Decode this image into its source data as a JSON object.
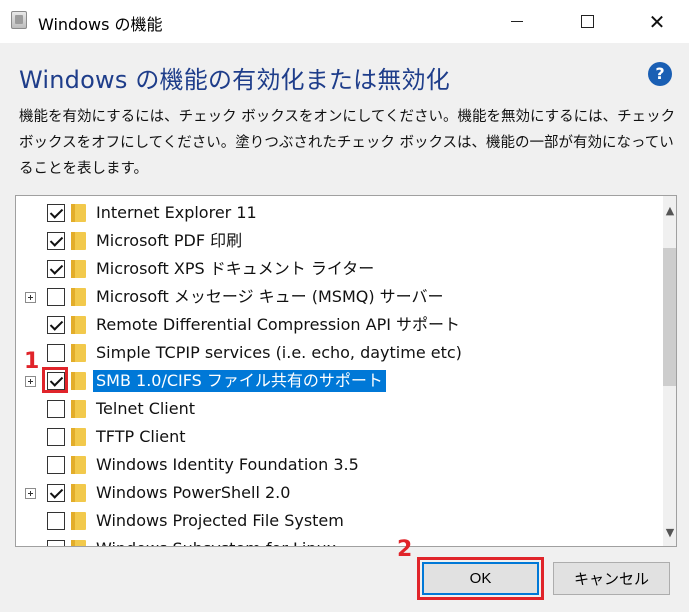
{
  "window": {
    "title": "Windows の機能",
    "controls": {
      "minimize": "minimize",
      "maximize": "maximize",
      "close": "✕"
    }
  },
  "heading": "Windows の機能の有効化または無効化",
  "help_icon": "?",
  "description_lines": [
    "機能を有効にするには、チェック ボックスをオンにしてください。機能を無効にするには、チェック",
    "ボックスをオフにしてください。塗りつぶされたチェック ボックスは、機能の一部が有効になってい",
    "ることを表します。"
  ],
  "features": [
    {
      "label": "Internet Explorer 11",
      "checked": true,
      "expandable": false,
      "selected": false
    },
    {
      "label": "Microsoft PDF 印刷",
      "checked": true,
      "expandable": false,
      "selected": false
    },
    {
      "label": "Microsoft XPS ドキュメント ライター",
      "checked": true,
      "expandable": false,
      "selected": false
    },
    {
      "label": "Microsoft メッセージ キュー (MSMQ) サーバー",
      "checked": false,
      "expandable": true,
      "selected": false
    },
    {
      "label": "Remote Differential Compression API サポート",
      "checked": true,
      "expandable": false,
      "selected": false
    },
    {
      "label": "Simple TCPIP services (i.e. echo, daytime etc)",
      "checked": false,
      "expandable": false,
      "selected": false
    },
    {
      "label": "SMB 1.0/CIFS ファイル共有のサポート",
      "checked": true,
      "expandable": true,
      "selected": true
    },
    {
      "label": "Telnet Client",
      "checked": false,
      "expandable": false,
      "selected": false
    },
    {
      "label": "TFTP Client",
      "checked": false,
      "expandable": false,
      "selected": false
    },
    {
      "label": "Windows Identity Foundation 3.5",
      "checked": false,
      "expandable": false,
      "selected": false
    },
    {
      "label": "Windows PowerShell 2.0",
      "checked": true,
      "expandable": true,
      "selected": false
    },
    {
      "label": "Windows Projected File System",
      "checked": false,
      "expandable": false,
      "selected": false
    },
    {
      "label": "Windows Subsystem for Linux",
      "checked": false,
      "expandable": false,
      "selected": false
    }
  ],
  "scrollbar": {
    "up": "▲",
    "down": "▼"
  },
  "annotations": {
    "step1": "1",
    "step2": "2"
  },
  "buttons": {
    "ok": "OK",
    "cancel": "キャンセル"
  },
  "colors": {
    "accent": "#0078d7",
    "heading": "#1e3d8a",
    "annotation": "#e0242a"
  }
}
